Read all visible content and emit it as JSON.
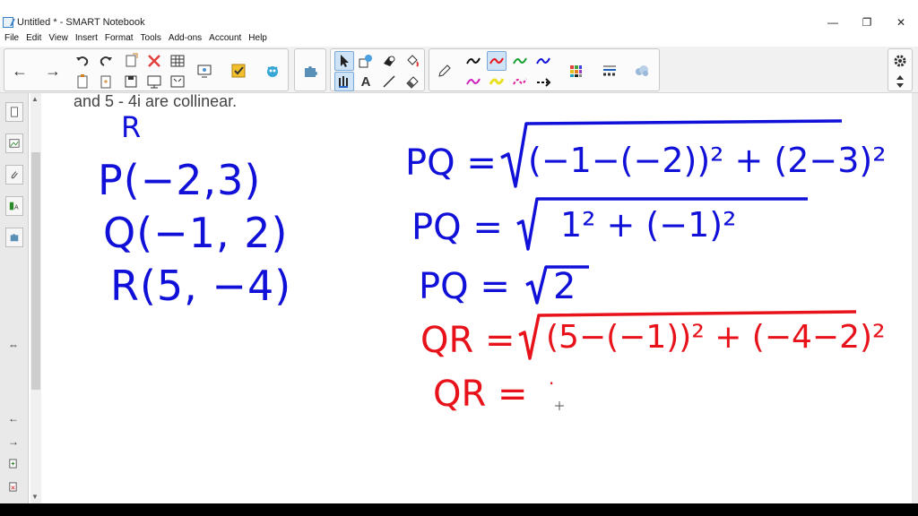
{
  "window": {
    "title": "Untitled * - SMART Notebook",
    "controls": {
      "minimize": "—",
      "restore": "❐",
      "close": "✕"
    }
  },
  "menu": [
    "File",
    "Edit",
    "View",
    "Insert",
    "Format",
    "Tools",
    "Add-ons",
    "Account",
    "Help"
  ],
  "toolbar": {
    "back": "←",
    "forward": "→",
    "text_tool_glyph": "A"
  },
  "sidebar": {
    "arrows": "⇔",
    "nav_left": "←",
    "nav_right": "→"
  },
  "canvas": {
    "intro_text": "and 5 - 4i are collinear.",
    "left_notes": {
      "label_r": "R",
      "point_p": "P(−2,3)",
      "point_q": "Q(−1, 2)",
      "point_r": "R(5, −4)"
    },
    "pq_line1": {
      "lhs": "PQ =",
      "radicand": "(−1−(−2))² + (2−3)²"
    },
    "pq_line2": {
      "lhs": "PQ =",
      "radicand": "1² + (−1)²"
    },
    "pq_line3": {
      "lhs": "PQ =",
      "radicand": "2"
    },
    "qr_line1": {
      "lhs": "QR =",
      "radicand": "(5−(−1))² + (−4−2)²"
    },
    "qr_line2": {
      "lhs": "QR =",
      "cursor": "·"
    }
  },
  "colors": {
    "blue_ink": "#1010d8",
    "red_ink": "#e8121a"
  }
}
